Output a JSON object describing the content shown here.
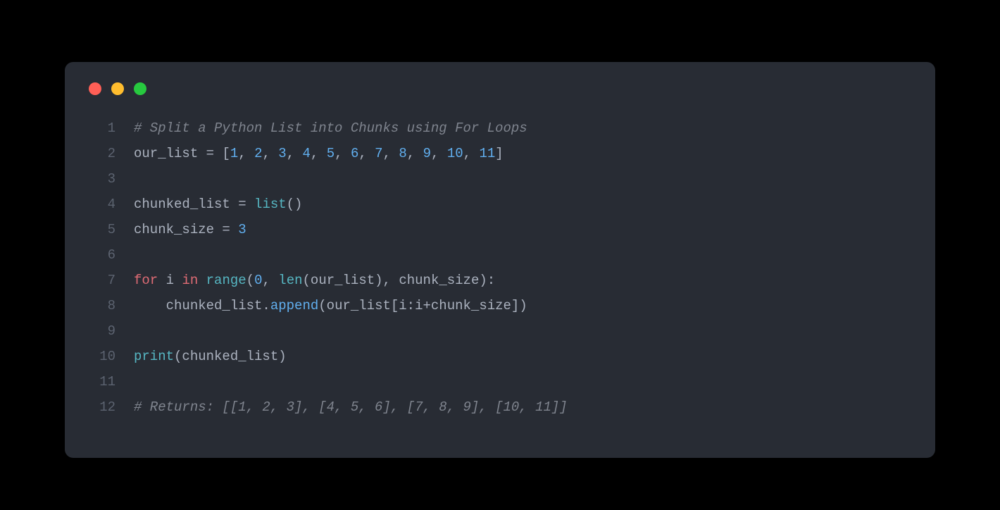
{
  "window": {
    "traffic": [
      "close",
      "minimize",
      "zoom"
    ]
  },
  "code": {
    "lines": [
      {
        "n": "1",
        "tokens": [
          {
            "cls": "tok-comment",
            "t": "# Split a Python List into Chunks using For Loops"
          }
        ]
      },
      {
        "n": "2",
        "tokens": [
          {
            "cls": "tok-ident",
            "t": "our_list "
          },
          {
            "cls": "tok-op",
            "t": "="
          },
          {
            "cls": "tok-ident",
            "t": " "
          },
          {
            "cls": "tok-punct",
            "t": "["
          },
          {
            "cls": "tok-num",
            "t": "1"
          },
          {
            "cls": "tok-punct",
            "t": ", "
          },
          {
            "cls": "tok-num",
            "t": "2"
          },
          {
            "cls": "tok-punct",
            "t": ", "
          },
          {
            "cls": "tok-num",
            "t": "3"
          },
          {
            "cls": "tok-punct",
            "t": ", "
          },
          {
            "cls": "tok-num",
            "t": "4"
          },
          {
            "cls": "tok-punct",
            "t": ", "
          },
          {
            "cls": "tok-num",
            "t": "5"
          },
          {
            "cls": "tok-punct",
            "t": ", "
          },
          {
            "cls": "tok-num",
            "t": "6"
          },
          {
            "cls": "tok-punct",
            "t": ", "
          },
          {
            "cls": "tok-num",
            "t": "7"
          },
          {
            "cls": "tok-punct",
            "t": ", "
          },
          {
            "cls": "tok-num",
            "t": "8"
          },
          {
            "cls": "tok-punct",
            "t": ", "
          },
          {
            "cls": "tok-num",
            "t": "9"
          },
          {
            "cls": "tok-punct",
            "t": ", "
          },
          {
            "cls": "tok-num",
            "t": "10"
          },
          {
            "cls": "tok-punct",
            "t": ", "
          },
          {
            "cls": "tok-num",
            "t": "11"
          },
          {
            "cls": "tok-punct",
            "t": "]"
          }
        ]
      },
      {
        "n": "3",
        "tokens": []
      },
      {
        "n": "4",
        "tokens": [
          {
            "cls": "tok-ident",
            "t": "chunked_list "
          },
          {
            "cls": "tok-op",
            "t": "="
          },
          {
            "cls": "tok-ident",
            "t": " "
          },
          {
            "cls": "tok-builtin",
            "t": "list"
          },
          {
            "cls": "tok-punct",
            "t": "()"
          }
        ]
      },
      {
        "n": "5",
        "tokens": [
          {
            "cls": "tok-ident",
            "t": "chunk_size "
          },
          {
            "cls": "tok-op",
            "t": "="
          },
          {
            "cls": "tok-ident",
            "t": " "
          },
          {
            "cls": "tok-num",
            "t": "3"
          }
        ]
      },
      {
        "n": "6",
        "tokens": []
      },
      {
        "n": "7",
        "tokens": [
          {
            "cls": "tok-kw-red",
            "t": "for"
          },
          {
            "cls": "tok-ident",
            "t": " i "
          },
          {
            "cls": "tok-kw-red",
            "t": "in"
          },
          {
            "cls": "tok-ident",
            "t": " "
          },
          {
            "cls": "tok-builtin",
            "t": "range"
          },
          {
            "cls": "tok-punct",
            "t": "("
          },
          {
            "cls": "tok-num",
            "t": "0"
          },
          {
            "cls": "tok-punct",
            "t": ", "
          },
          {
            "cls": "tok-builtin",
            "t": "len"
          },
          {
            "cls": "tok-punct",
            "t": "(our_list), chunk_size):"
          }
        ]
      },
      {
        "n": "8",
        "tokens": [
          {
            "cls": "tok-ident",
            "t": "    chunked_list."
          },
          {
            "cls": "tok-call",
            "t": "append"
          },
          {
            "cls": "tok-punct",
            "t": "(our_list[i:i"
          },
          {
            "cls": "tok-op",
            "t": "+"
          },
          {
            "cls": "tok-punct",
            "t": "chunk_size])"
          }
        ]
      },
      {
        "n": "9",
        "tokens": []
      },
      {
        "n": "10",
        "tokens": [
          {
            "cls": "tok-builtin",
            "t": "print"
          },
          {
            "cls": "tok-punct",
            "t": "(chunked_list)"
          }
        ]
      },
      {
        "n": "11",
        "tokens": []
      },
      {
        "n": "12",
        "tokens": [
          {
            "cls": "tok-comment",
            "t": "# Returns: [[1, 2, 3], [4, 5, 6], [7, 8, 9], [10, 11]]"
          }
        ]
      }
    ]
  }
}
